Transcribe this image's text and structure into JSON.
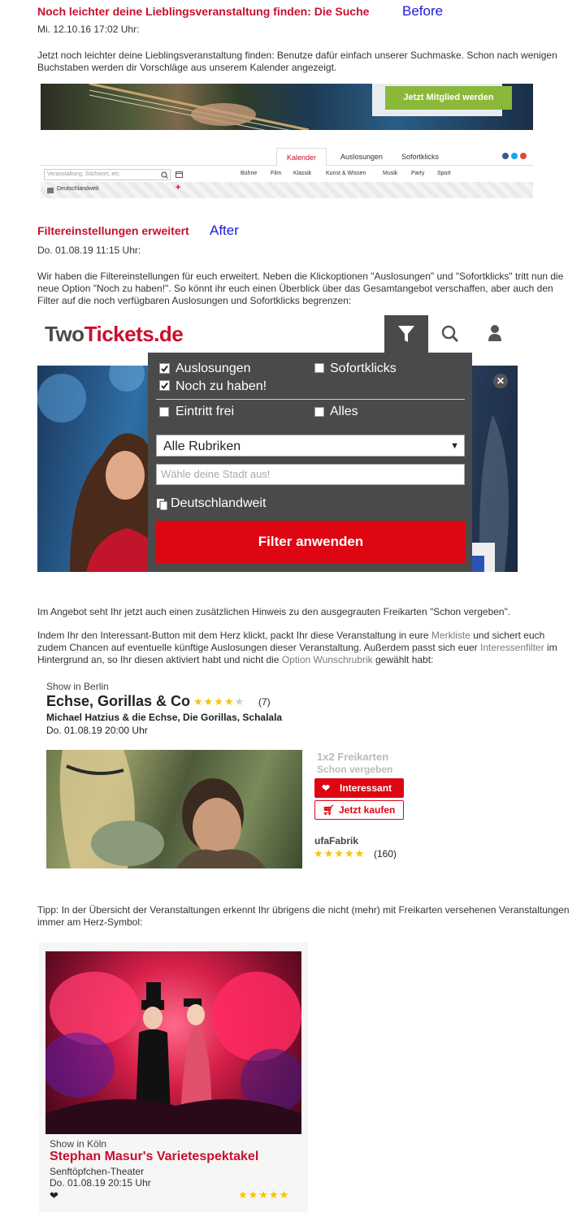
{
  "before": {
    "title": "Noch leichter deine Lieblingsveranstaltung finden: Die Suche",
    "tag": "Before",
    "date": "Mi. 12.10.16 17:02 Uhr:",
    "text": "Jetzt noch leichter deine Lieblingsveranstaltung finden: Benutze dafür einfach unserer Suchmaske. Schon nach wenigen Buchstaben werden dir Vorschläge aus unserem Kalender angezeigt.",
    "member_button": "Jetzt Mitglied werden",
    "tabs": [
      "Kalender",
      "Auslosungen",
      "Sofortklicks"
    ],
    "search_placeholder": "Veranstaltung, Stichwort, etc.",
    "location": "Deutschlandweit",
    "categories": [
      "Bühne",
      "Film",
      "Klassik",
      "Kunst & Wissen",
      "Musik",
      "Party",
      "Sport"
    ]
  },
  "after": {
    "title": "Filtereinstellungen erweitert",
    "tag": "After",
    "date": "Do. 01.08.19 11:15 Uhr:",
    "text": "Wir haben die Filtereinstellungen für euch erweitert. Neben die Klickoptionen \"Auslosungen\" und \"Sofortklicks\" tritt nun die neue Option \"Noch zu haben!\". So könnt ihr euch einen Überblick über das Gesamtangebot verschaffen, aber auch den Filter auf die noch verfügbaren Auslosungen und Sofortklicks begrenzen:",
    "logo_two": "Two",
    "logo_tickets": "Tickets.de",
    "filter": {
      "auslosungen": "Auslosungen",
      "sofortklicks": "Sofortklicks",
      "noch": "Noch zu haben!",
      "eintritt": "Eintritt frei",
      "alles": "Alles",
      "rubriken": "Alle Rubriken",
      "city_placeholder": "Wähle deine Stadt aus!",
      "location": "Deutschlandweit",
      "apply": "Filter anwenden"
    }
  },
  "p1": "Im Angebot seht Ihr jetzt auch einen zusätzlichen Hinweis zu den ausgegrauten Freikarten \"Schon vergeben\".",
  "p2": {
    "a": "Indem Ihr den Interessant-Button mit dem Herz klickt, packt Ihr diese Veranstaltung in eure ",
    "link1": "Merkliste",
    "b": " und sichert euch zudem Chancen auf eventuelle künftige Auslosungen dieser Veranstaltung. Außerdem passt sich euer ",
    "link2": "Interessenfilter",
    "c": " im Hintergrund an, so Ihr diesen aktiviert habt und nicht die ",
    "link3": "Option Wunschrubrik",
    "d": " gewählt habt:"
  },
  "event1": {
    "category": "Show in Berlin",
    "title": "Echse, Gorillas & Co",
    "count": "(7)",
    "performers": "Michael Hatzius & die Echse, Die Gorillas, Schalala",
    "date": "Do. 01.08.19 20:00 Uhr",
    "freikarten": "1x2 Freikarten",
    "vergeben": "Schon vergeben",
    "interessant": "Interessant",
    "kaufen": "Jetzt kaufen",
    "venue": "ufaFabrik",
    "venue_count": "(160)"
  },
  "tipp": "Tipp: In der Übersicht der Veranstaltungen erkennt Ihr übrigens die nicht (mehr) mit Freikarten versehenen Veranstaltungen immer am Herz-Symbol:",
  "event2": {
    "category": "Show in Köln",
    "title": "Stephan Masur's Varietespektakel",
    "venue": "Senftöpfchen-Theater",
    "date": "Do. 01.08.19 20:15 Uhr"
  }
}
